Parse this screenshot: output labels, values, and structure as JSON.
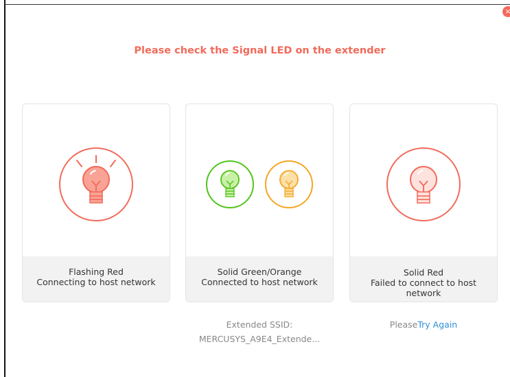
{
  "dialog": {
    "title": "Please check the Signal LED on the extender",
    "close_symbol": "×"
  },
  "cards": [
    {
      "state": "Flashing Red",
      "description": "Connecting to host network",
      "icon": "flashing-red-bulb-icon"
    },
    {
      "state": "Solid Green/Orange",
      "description": "Connected to host network",
      "icon": "green-orange-bulb-icons"
    },
    {
      "state": "Solid Red",
      "description_line1": "Failed to connect to host",
      "description_line2": "network",
      "icon": "solid-red-bulb-icon"
    }
  ],
  "ssid": {
    "label": "Extended SSID:",
    "value": "MERCUSYS_A9E4_Extende..."
  },
  "retry": {
    "prefix": "Please",
    "link": "Try Again"
  },
  "colors": {
    "red": "#f26a5a",
    "green": "#52c41a",
    "orange": "#f5a623",
    "link": "#2d8fd8"
  }
}
